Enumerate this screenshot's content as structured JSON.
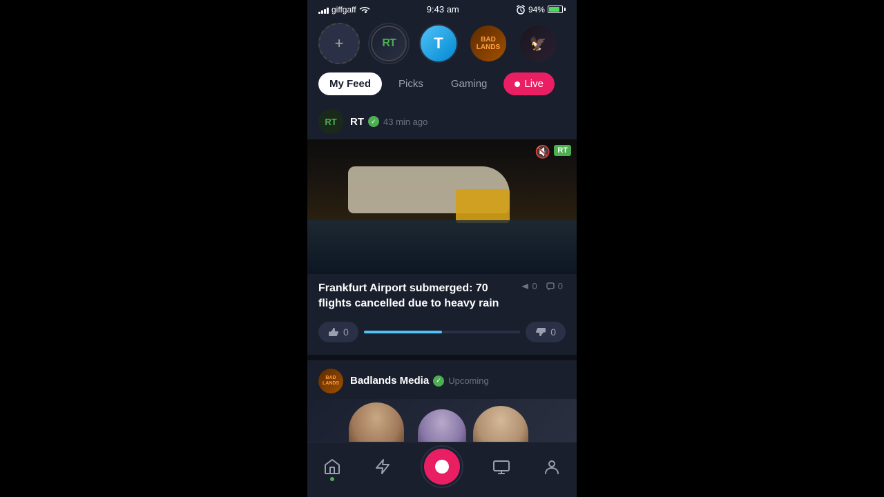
{
  "statusBar": {
    "carrier": "giffgaff",
    "time": "9:43 am",
    "battery": "94%"
  },
  "stories": [
    {
      "id": "add",
      "type": "add",
      "label": "+"
    },
    {
      "id": "rt",
      "type": "rt",
      "label": "RT"
    },
    {
      "id": "t",
      "type": "t",
      "label": "T"
    },
    {
      "id": "badlands",
      "type": "badlands",
      "label": "BADLANDS"
    },
    {
      "id": "avatar5",
      "type": "avatar5",
      "label": ""
    }
  ],
  "tabs": [
    {
      "id": "my-feed",
      "label": "My Feed",
      "active": true
    },
    {
      "id": "picks",
      "label": "Picks",
      "active": false
    },
    {
      "id": "gaming",
      "label": "Gaming",
      "active": false
    },
    {
      "id": "live",
      "label": "Live",
      "active": false
    }
  ],
  "posts": [
    {
      "id": "post1",
      "author": "RT",
      "verified": true,
      "timeAgo": "43 min ago",
      "title": "Frankfurt Airport submerged: 70 flights cancelled due to heavy rain",
      "views": "0",
      "comments": "0",
      "thumbsUp": "0",
      "thumbsDown": "0",
      "watermark": "RT"
    },
    {
      "id": "post2",
      "author": "Badlands Media",
      "verified": true,
      "status": "Upcoming"
    }
  ],
  "nav": {
    "home": "Home",
    "lightning": "Activity",
    "record": "Record",
    "screen": "Screen",
    "profile": "Profile"
  }
}
